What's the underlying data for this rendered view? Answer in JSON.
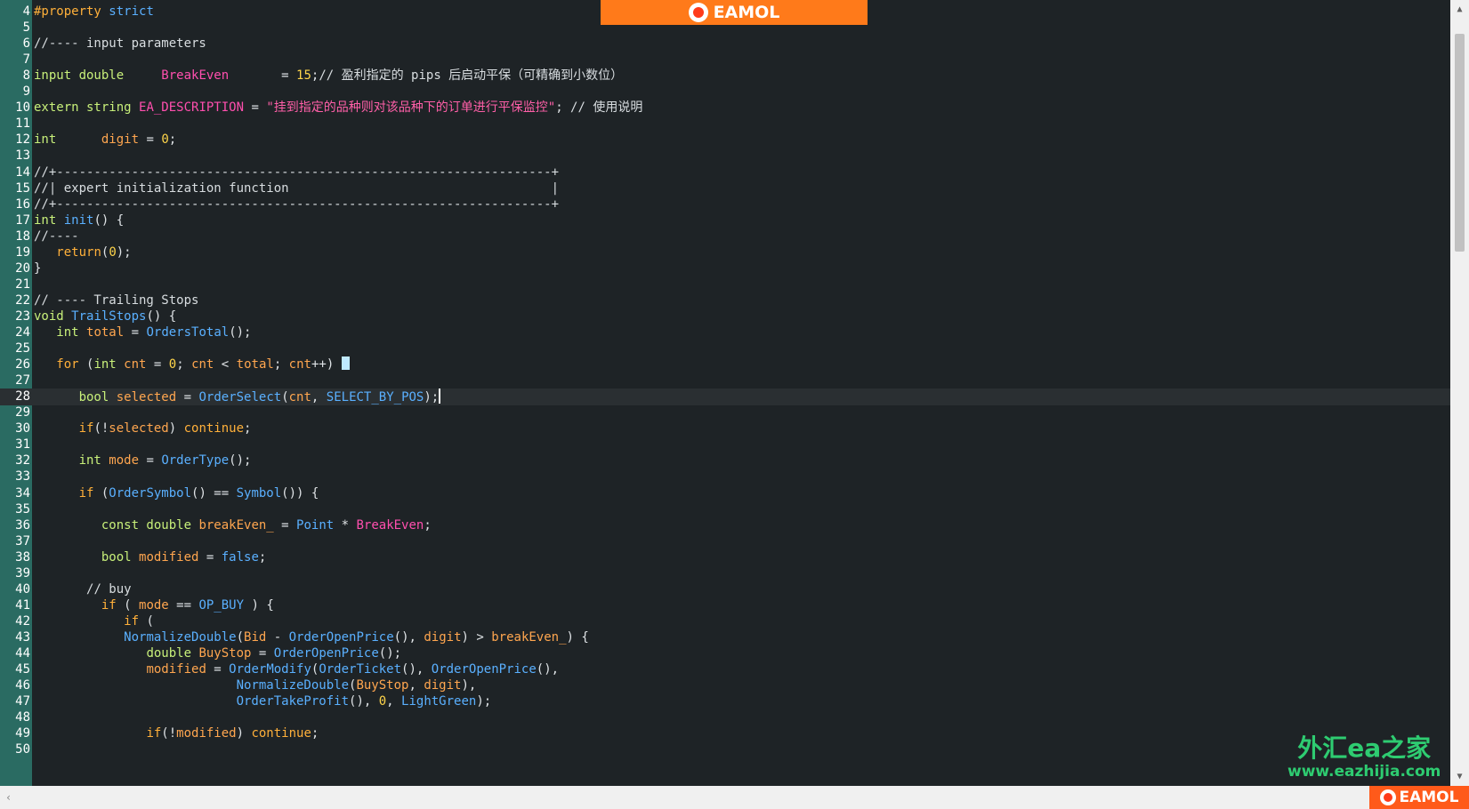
{
  "brand": {
    "name": "EAMOL"
  },
  "watermark": {
    "line1": "外汇ea之家",
    "line2": "www.eazhijia.com"
  },
  "editor": {
    "current_line": 28,
    "lines": [
      {
        "n": 4,
        "tokens": [
          [
            "kw",
            "#property "
          ],
          [
            "fn",
            "strict"
          ]
        ]
      },
      {
        "n": 5,
        "tokens": []
      },
      {
        "n": 6,
        "tokens": [
          [
            "cm",
            "//---- input parameters"
          ]
        ]
      },
      {
        "n": 7,
        "tokens": []
      },
      {
        "n": 8,
        "tokens": [
          [
            "type",
            "input double     "
          ],
          [
            "const",
            "BreakEven"
          ],
          [
            "pl",
            "       = "
          ],
          [
            "num",
            "15"
          ],
          [
            "pl",
            ";"
          ],
          [
            "cm",
            "// 盈利指定的 pips 后启动平保（可精确到小数位）"
          ]
        ]
      },
      {
        "n": 9,
        "tokens": []
      },
      {
        "n": 10,
        "tokens": [
          [
            "type",
            "extern string "
          ],
          [
            "const",
            "EA_DESCRIPTION"
          ],
          [
            "pl",
            " = "
          ],
          [
            "str",
            "\"挂到指定的品种则对该品种下的订单进行平保监控\""
          ],
          [
            "pl",
            "; "
          ],
          [
            "cm",
            "// 使用说明"
          ]
        ]
      },
      {
        "n": 11,
        "tokens": []
      },
      {
        "n": 12,
        "tokens": [
          [
            "type",
            "int      "
          ],
          [
            "var",
            "digit"
          ],
          [
            "pl",
            " = "
          ],
          [
            "num",
            "0"
          ],
          [
            "pl",
            ";"
          ]
        ]
      },
      {
        "n": 13,
        "tokens": []
      },
      {
        "n": 14,
        "tokens": [
          [
            "cm",
            "//+------------------------------------------------------------------+"
          ]
        ]
      },
      {
        "n": 15,
        "tokens": [
          [
            "cm",
            "//| expert initialization function                                   |"
          ]
        ]
      },
      {
        "n": 16,
        "tokens": [
          [
            "cm",
            "//+------------------------------------------------------------------+"
          ]
        ]
      },
      {
        "n": 17,
        "tokens": [
          [
            "type",
            "int "
          ],
          [
            "fn",
            "init"
          ],
          [
            "pl",
            "() {"
          ]
        ]
      },
      {
        "n": 18,
        "tokens": [
          [
            "cm",
            "//----"
          ]
        ]
      },
      {
        "n": 19,
        "tokens": [
          [
            "pl",
            "   "
          ],
          [
            "kw",
            "return"
          ],
          [
            "pl",
            "("
          ],
          [
            "num",
            "0"
          ],
          [
            "pl",
            ");"
          ]
        ]
      },
      {
        "n": 20,
        "tokens": [
          [
            "pl",
            "}"
          ]
        ]
      },
      {
        "n": 21,
        "tokens": []
      },
      {
        "n": 22,
        "tokens": [
          [
            "cm",
            "// ---- Trailing Stops"
          ]
        ]
      },
      {
        "n": 23,
        "tokens": [
          [
            "type",
            "void "
          ],
          [
            "fn",
            "TrailStops"
          ],
          [
            "pl",
            "() {"
          ]
        ]
      },
      {
        "n": 24,
        "tokens": [
          [
            "pl",
            "   "
          ],
          [
            "type",
            "int "
          ],
          [
            "var",
            "total"
          ],
          [
            "pl",
            " = "
          ],
          [
            "fn",
            "OrdersTotal"
          ],
          [
            "pl",
            "();"
          ]
        ]
      },
      {
        "n": 25,
        "tokens": []
      },
      {
        "n": 26,
        "tokens": [
          [
            "pl",
            "   "
          ],
          [
            "kw",
            "for"
          ],
          [
            "pl",
            " ("
          ],
          [
            "type",
            "int "
          ],
          [
            "var",
            "cnt"
          ],
          [
            "pl",
            " = "
          ],
          [
            "num",
            "0"
          ],
          [
            "pl",
            "; "
          ],
          [
            "var",
            "cnt"
          ],
          [
            "pl",
            " < "
          ],
          [
            "var",
            "total"
          ],
          [
            "pl",
            "; "
          ],
          [
            "var",
            "cnt"
          ],
          [
            "pl",
            "++) "
          ],
          [
            "box",
            "{"
          ]
        ]
      },
      {
        "n": 27,
        "tokens": []
      },
      {
        "n": 28,
        "tokens": [
          [
            "pl",
            "      "
          ],
          [
            "type",
            "bool "
          ],
          [
            "var",
            "selected"
          ],
          [
            "pl",
            " = "
          ],
          [
            "fn",
            "OrderSelect"
          ],
          [
            "pl",
            "("
          ],
          [
            "var",
            "cnt"
          ],
          [
            "pl",
            ", "
          ],
          [
            "fn",
            "SELECT_BY_POS"
          ],
          [
            "pl",
            ");"
          ],
          [
            "caret",
            ""
          ]
        ]
      },
      {
        "n": 29,
        "tokens": []
      },
      {
        "n": 30,
        "tokens": [
          [
            "pl",
            "      "
          ],
          [
            "kw",
            "if"
          ],
          [
            "pl",
            "(!"
          ],
          [
            "var",
            "selected"
          ],
          [
            "pl",
            ") "
          ],
          [
            "kw",
            "continue"
          ],
          [
            "pl",
            ";"
          ]
        ]
      },
      {
        "n": 31,
        "tokens": []
      },
      {
        "n": 32,
        "tokens": [
          [
            "pl",
            "      "
          ],
          [
            "type",
            "int "
          ],
          [
            "var",
            "mode"
          ],
          [
            "pl",
            " = "
          ],
          [
            "fn",
            "OrderType"
          ],
          [
            "pl",
            "();"
          ]
        ]
      },
      {
        "n": 33,
        "tokens": []
      },
      {
        "n": 34,
        "tokens": [
          [
            "pl",
            "      "
          ],
          [
            "kw",
            "if"
          ],
          [
            "pl",
            " ("
          ],
          [
            "fn",
            "OrderSymbol"
          ],
          [
            "pl",
            "() == "
          ],
          [
            "fn",
            "Symbol"
          ],
          [
            "pl",
            "()) {"
          ]
        ]
      },
      {
        "n": 35,
        "tokens": []
      },
      {
        "n": 36,
        "tokens": [
          [
            "pl",
            "         "
          ],
          [
            "type",
            "const double "
          ],
          [
            "var",
            "breakEven_"
          ],
          [
            "pl",
            " = "
          ],
          [
            "fn",
            "Point"
          ],
          [
            "pl",
            " * "
          ],
          [
            "const",
            "BreakEven"
          ],
          [
            "pl",
            ";"
          ]
        ]
      },
      {
        "n": 37,
        "tokens": []
      },
      {
        "n": 38,
        "tokens": [
          [
            "pl",
            "         "
          ],
          [
            "type",
            "bool "
          ],
          [
            "var",
            "modified"
          ],
          [
            "pl",
            " = "
          ],
          [
            "fn",
            "false"
          ],
          [
            "pl",
            ";"
          ]
        ]
      },
      {
        "n": 39,
        "tokens": []
      },
      {
        "n": 40,
        "tokens": [
          [
            "pl",
            "       "
          ],
          [
            "cm",
            "// buy"
          ]
        ]
      },
      {
        "n": 41,
        "tokens": [
          [
            "pl",
            "         "
          ],
          [
            "kw",
            "if"
          ],
          [
            "pl",
            " ( "
          ],
          [
            "var",
            "mode"
          ],
          [
            "pl",
            " == "
          ],
          [
            "fn",
            "OP_BUY"
          ],
          [
            "pl",
            " ) {"
          ]
        ]
      },
      {
        "n": 42,
        "tokens": [
          [
            "pl",
            "            "
          ],
          [
            "kw",
            "if"
          ],
          [
            "pl",
            " ("
          ]
        ]
      },
      {
        "n": 43,
        "tokens": [
          [
            "pl",
            "            "
          ],
          [
            "fn",
            "NormalizeDouble"
          ],
          [
            "pl",
            "("
          ],
          [
            "var",
            "Bid"
          ],
          [
            "pl",
            " - "
          ],
          [
            "fn",
            "OrderOpenPrice"
          ],
          [
            "pl",
            "(), "
          ],
          [
            "var",
            "digit"
          ],
          [
            "pl",
            ") > "
          ],
          [
            "var",
            "breakEven_"
          ],
          [
            "pl",
            ") {"
          ]
        ]
      },
      {
        "n": 44,
        "tokens": [
          [
            "pl",
            "               "
          ],
          [
            "type",
            "double "
          ],
          [
            "var",
            "BuyStop"
          ],
          [
            "pl",
            " = "
          ],
          [
            "fn",
            "OrderOpenPrice"
          ],
          [
            "pl",
            "();"
          ]
        ]
      },
      {
        "n": 45,
        "tokens": [
          [
            "pl",
            "               "
          ],
          [
            "var",
            "modified"
          ],
          [
            "pl",
            " = "
          ],
          [
            "fn",
            "OrderModify"
          ],
          [
            "pl",
            "("
          ],
          [
            "fn",
            "OrderTicket"
          ],
          [
            "pl",
            "(), "
          ],
          [
            "fn",
            "OrderOpenPrice"
          ],
          [
            "pl",
            "(),"
          ]
        ]
      },
      {
        "n": 46,
        "tokens": [
          [
            "pl",
            "                           "
          ],
          [
            "fn",
            "NormalizeDouble"
          ],
          [
            "pl",
            "("
          ],
          [
            "var",
            "BuyStop"
          ],
          [
            "pl",
            ", "
          ],
          [
            "var",
            "digit"
          ],
          [
            "pl",
            "),"
          ]
        ]
      },
      {
        "n": 47,
        "tokens": [
          [
            "pl",
            "                           "
          ],
          [
            "fn",
            "OrderTakeProfit"
          ],
          [
            "pl",
            "(), "
          ],
          [
            "num",
            "0"
          ],
          [
            "pl",
            ", "
          ],
          [
            "fn",
            "LightGreen"
          ],
          [
            "pl",
            ");"
          ]
        ]
      },
      {
        "n": 48,
        "tokens": []
      },
      {
        "n": 49,
        "tokens": [
          [
            "pl",
            "               "
          ],
          [
            "kw",
            "if"
          ],
          [
            "pl",
            "(!"
          ],
          [
            "var",
            "modified"
          ],
          [
            "pl",
            ") "
          ],
          [
            "kw",
            "continue"
          ],
          [
            "pl",
            ";"
          ]
        ]
      },
      {
        "n": 50,
        "tokens": []
      }
    ]
  },
  "colors": {
    "gutter": "#2a6b62",
    "background": "#1e2326",
    "brand_orange": "#ff7a1a"
  }
}
